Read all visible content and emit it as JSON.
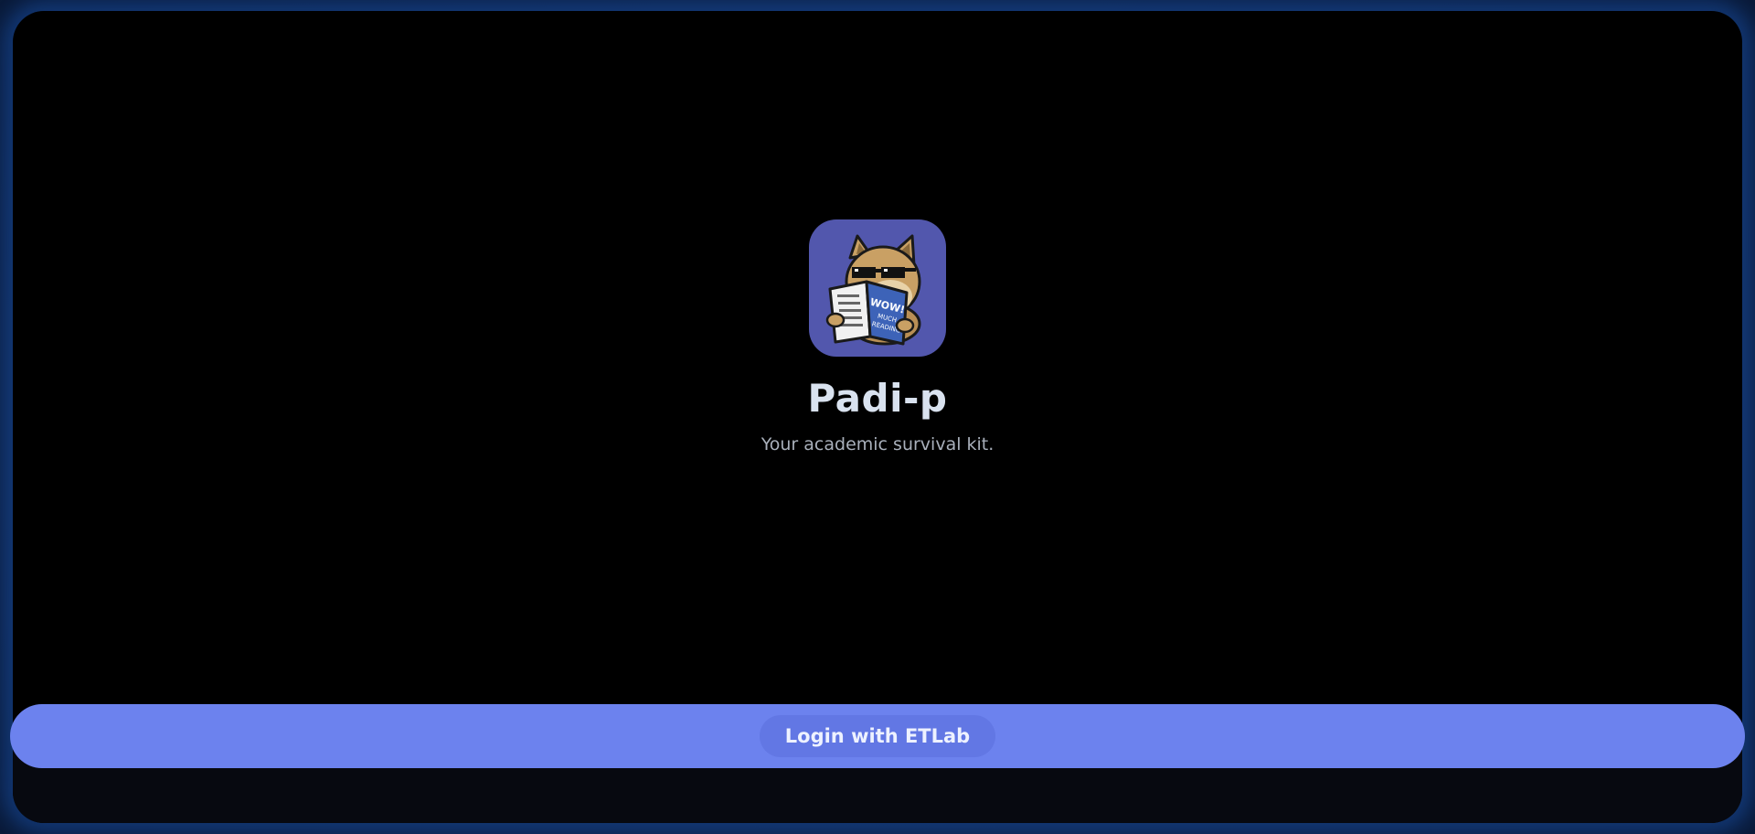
{
  "app": {
    "title": "Padi-p",
    "tagline": "Your academic survival kit."
  },
  "logo": {
    "icon": "doge-reading-icon",
    "book_text": [
      "WOW!",
      "MUCH",
      "READING"
    ],
    "background": "#5257ad"
  },
  "login": {
    "label": "Login with ETLab",
    "color": "#6c82ee"
  }
}
